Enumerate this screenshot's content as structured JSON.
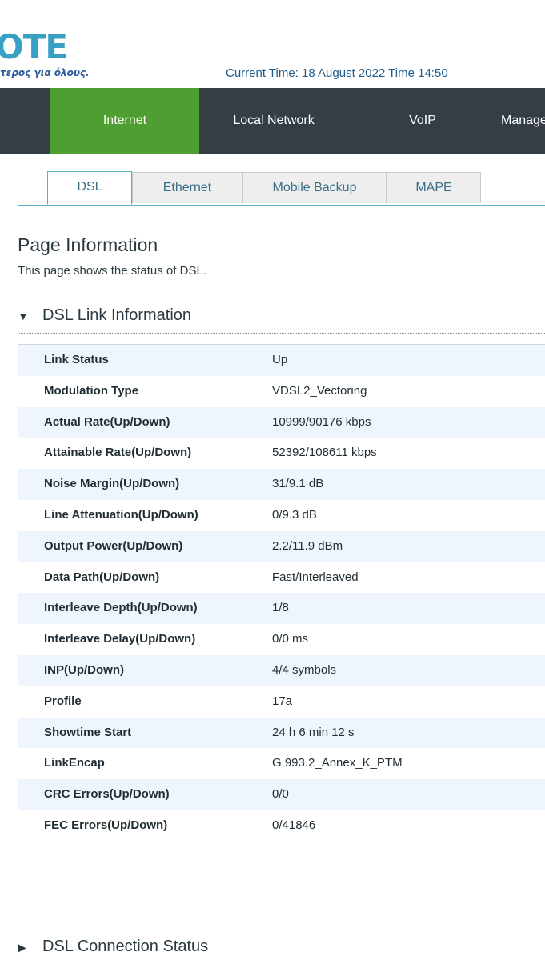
{
  "brand": {
    "logo_text": "OTE",
    "tagline": "τερος για όλους."
  },
  "header": {
    "current_time": "Current Time: 18 August 2022 Time 14:50"
  },
  "nav": {
    "items": [
      {
        "label": "Internet",
        "active": true
      },
      {
        "label": "Local Network",
        "active": false
      },
      {
        "label": "VoIP",
        "active": false
      },
      {
        "label": "Manage",
        "active": false
      }
    ]
  },
  "subtabs": [
    {
      "label": "DSL",
      "active": true
    },
    {
      "label": "Ethernet",
      "active": false
    },
    {
      "label": "Mobile Backup",
      "active": false
    },
    {
      "label": "MAPE",
      "active": false
    }
  ],
  "page": {
    "title": "Page Information",
    "description": "This page shows the status of DSL."
  },
  "sections": {
    "link_info": {
      "title": "DSL Link Information",
      "expanded": true,
      "icon": "triangle-down-icon"
    },
    "connection_status": {
      "title": "DSL Connection Status",
      "expanded": false,
      "icon": "triangle-right-icon"
    }
  },
  "link_info_rows": [
    {
      "label": "Link Status",
      "value": "Up"
    },
    {
      "label": "Modulation Type",
      "value": "VDSL2_Vectoring"
    },
    {
      "label": "Actual Rate(Up/Down)",
      "value": "10999/90176 kbps"
    },
    {
      "label": "Attainable Rate(Up/Down)",
      "value": "52392/108611 kbps"
    },
    {
      "label": "Noise Margin(Up/Down)",
      "value": "31/9.1 dB"
    },
    {
      "label": "Line Attenuation(Up/Down)",
      "value": "0/9.3 dB"
    },
    {
      "label": "Output Power(Up/Down)",
      "value": "2.2/11.9 dBm"
    },
    {
      "label": "Data Path(Up/Down)",
      "value": "Fast/Interleaved"
    },
    {
      "label": "Interleave Depth(Up/Down)",
      "value": "1/8"
    },
    {
      "label": "Interleave Delay(Up/Down)",
      "value": "0/0 ms"
    },
    {
      "label": "INP(Up/Down)",
      "value": "4/4 symbols"
    },
    {
      "label": "Profile",
      "value": "17a"
    },
    {
      "label": "Showtime Start",
      "value": "24 h 6 min 12 s"
    },
    {
      "label": "LinkEncap",
      "value": "G.993.2_Annex_K_PTM"
    },
    {
      "label": "CRC Errors(Up/Down)",
      "value": "0/0"
    },
    {
      "label": "FEC Errors(Up/Down)",
      "value": "0/41846"
    }
  ],
  "colors": {
    "nav_bg": "#363e45",
    "nav_active": "#4e9e32",
    "accent": "#57b0c4",
    "row_alt": "#eef5fd"
  }
}
